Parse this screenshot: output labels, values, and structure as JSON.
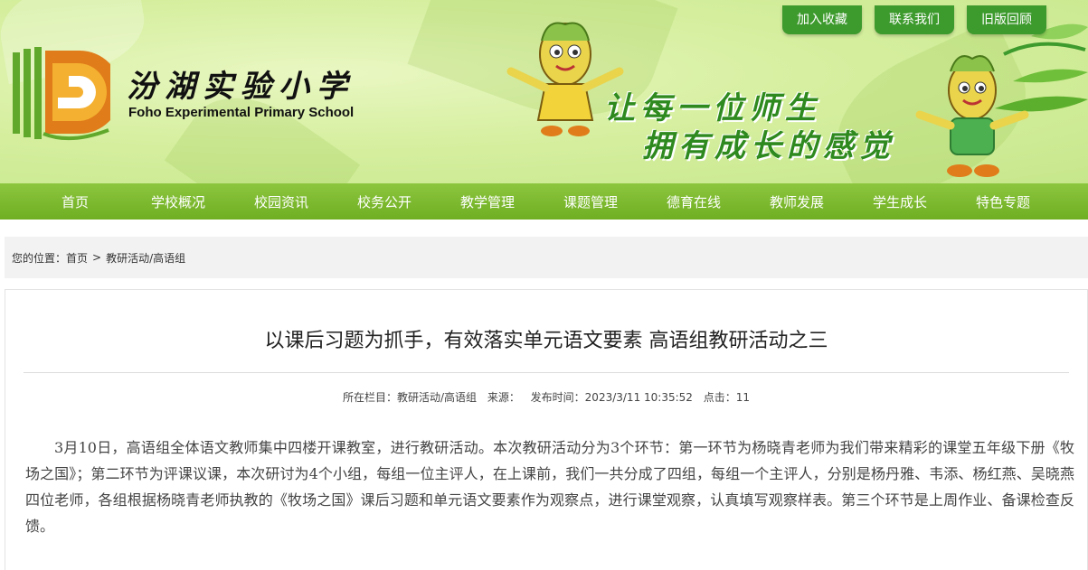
{
  "header": {
    "school_name_cn": "汾湖实验小学",
    "school_name_en": "Foho Experimental Primary School",
    "slogan_line1": "让每一位师生",
    "slogan_line2": "拥有成长的感觉",
    "top_links": [
      "加入收藏",
      "联系我们",
      "旧版回顾"
    ]
  },
  "nav": {
    "items": [
      "首页",
      "学校概况",
      "校园资讯",
      "校务公开",
      "教学管理",
      "课题管理",
      "德育在线",
      "教师发展",
      "学生成长",
      "特色专题"
    ]
  },
  "breadcrumb": {
    "prefix": "您的位置：",
    "home": "首页",
    "separator": ">",
    "current": "教研活动/高语组"
  },
  "article": {
    "title": "以课后习题为抓手，有效落实单元语文要素 高语组教研活动之三",
    "meta": {
      "column": "所在栏目：教研活动/高语组",
      "source": "来源：",
      "publish_time": "发布时间：2023/3/11 10:35:52",
      "clicks": "点击：11"
    },
    "content": "3月10日，高语组全体语文教师集中四楼开课教室，进行教研活动。本次教研活动分为3个环节：第一环节为杨晓青老师为我们带来精彩的课堂五年级下册《牧场之国》；第二环节为评课议课，本次研讨为4个小组，每组一位主评人，在上课前，我们一共分成了四组，每组一个主评人，分别是杨丹雅、韦添、杨红燕、吴晓燕四位老师，各组根据杨晓青老师执教的《牧场之国》课后习题和单元语文要素作为观察点，进行课堂观察，认真填写观察样表。第三个环节是上周作业、备课检查反馈。"
  },
  "colors": {
    "nav_green": "#7ab82c",
    "button_green": "#3d9a2d",
    "slogan_green": "#2e8a1e",
    "logo_orange": "#e07c1a"
  },
  "icons": {
    "logo": "school-logo-icon",
    "mascot": "corn-mascot-icon"
  }
}
